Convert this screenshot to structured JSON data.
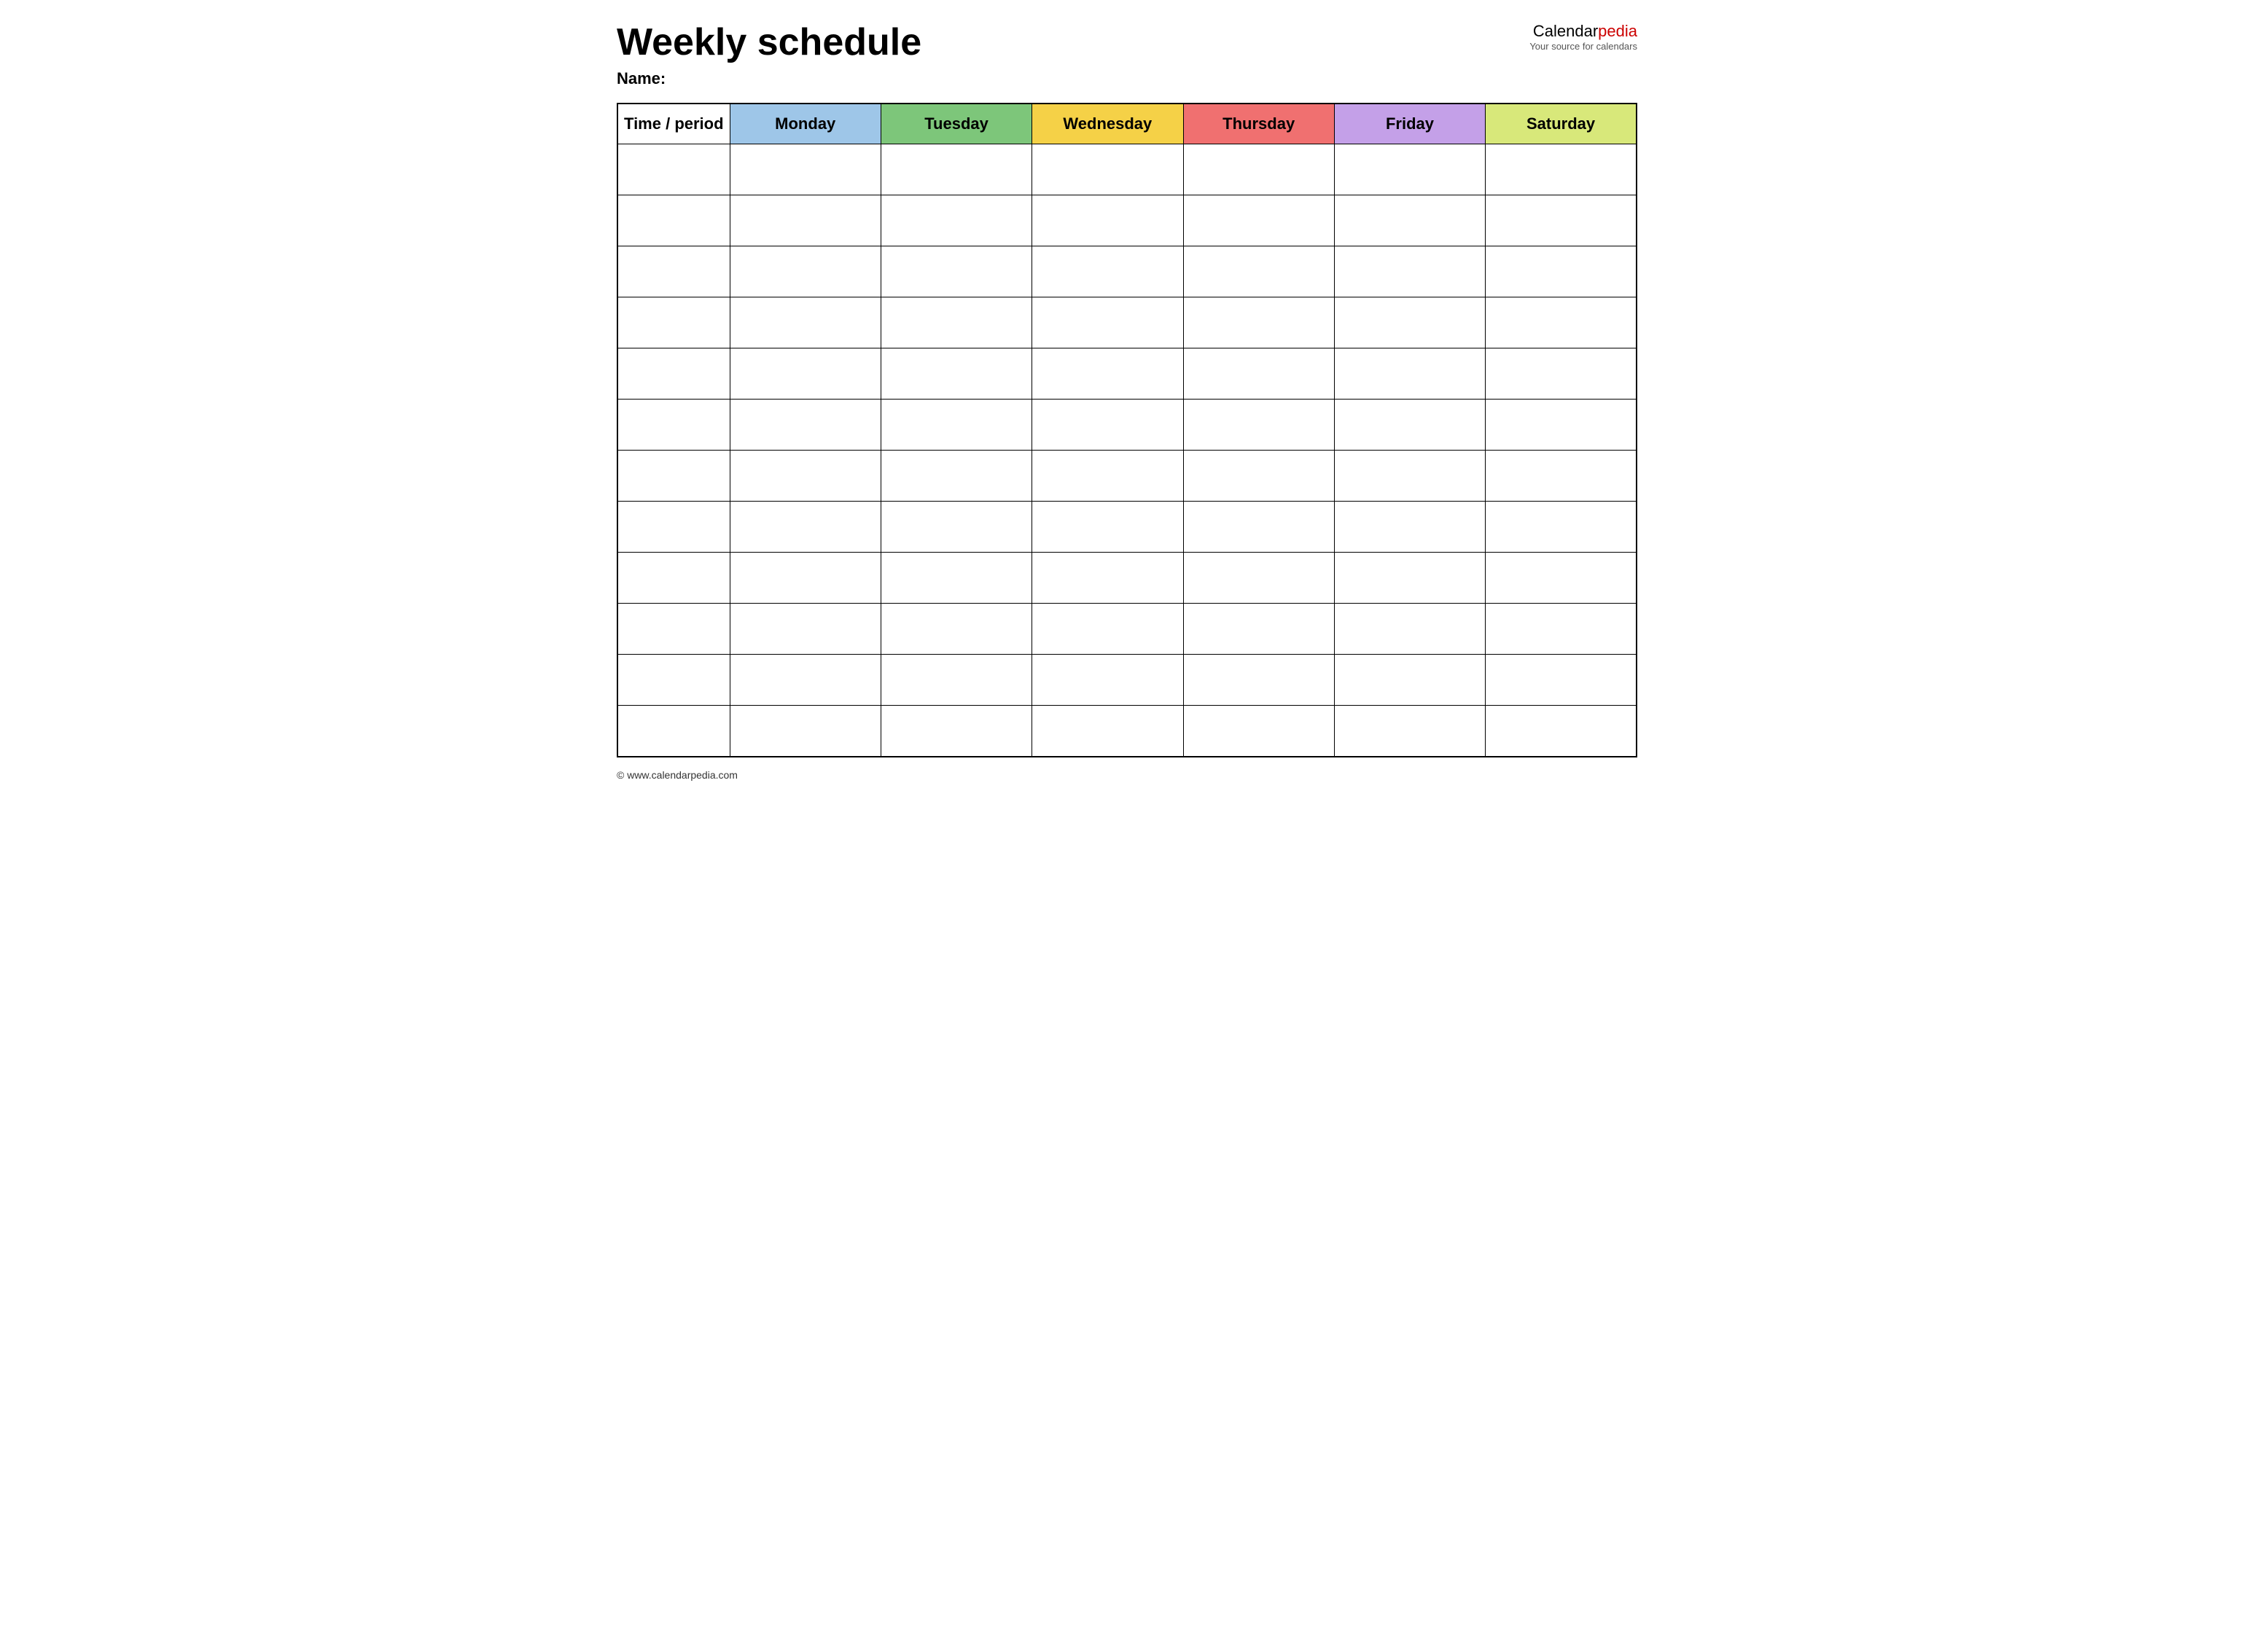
{
  "header": {
    "title": "Weekly schedule",
    "name_label": "Name:",
    "logo": {
      "calendar_text": "Calendar",
      "pedia_text": "pedia",
      "subtitle": "Your source for calendars"
    }
  },
  "table": {
    "columns": [
      {
        "key": "time",
        "label": "Time / period",
        "color": "#ffffff"
      },
      {
        "key": "monday",
        "label": "Monday",
        "color": "#9ec6e8"
      },
      {
        "key": "tuesday",
        "label": "Tuesday",
        "color": "#7dc67a"
      },
      {
        "key": "wednesday",
        "label": "Wednesday",
        "color": "#f5d147"
      },
      {
        "key": "thursday",
        "label": "Thursday",
        "color": "#f07070"
      },
      {
        "key": "friday",
        "label": "Friday",
        "color": "#c4a0e8"
      },
      {
        "key": "saturday",
        "label": "Saturday",
        "color": "#d8e87a"
      }
    ],
    "row_count": 12
  },
  "footer": {
    "url": "© www.calendarpedia.com"
  }
}
